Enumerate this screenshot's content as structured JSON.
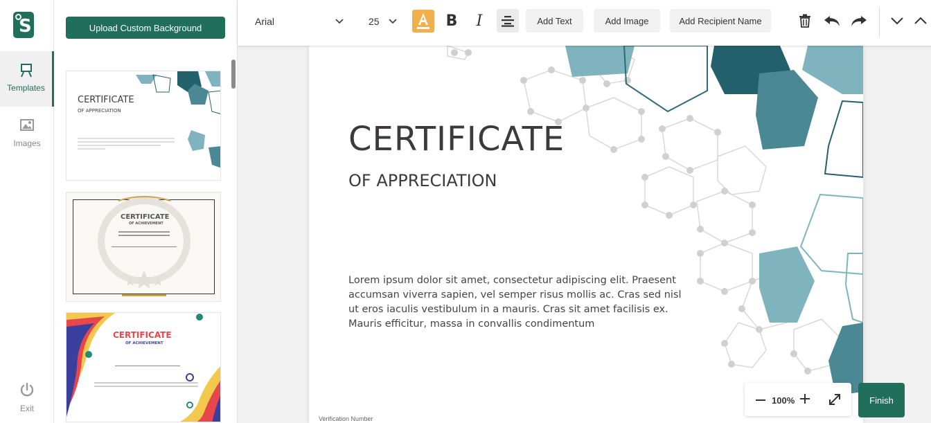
{
  "nav": {
    "items": [
      {
        "label": "Templates",
        "icon": "easel-icon",
        "active": true
      },
      {
        "label": "Images",
        "icon": "image-icon",
        "active": false
      }
    ],
    "exit_label": "Exit"
  },
  "panel": {
    "upload_label": "Upload Custom Background",
    "templates": [
      {
        "title": "CERTIFICATE",
        "subtitle": "OF APPRECIATION"
      },
      {
        "title": "CERTIFICATE",
        "subtitle": "OF ACHIEVEMENT"
      },
      {
        "title": "CERTIFICATE",
        "subtitle": "OF ACHIEVEMENT"
      }
    ]
  },
  "toolbar": {
    "font": "Arial",
    "font_size": "25",
    "add_text": "Add Text",
    "add_image": "Add Image",
    "add_recipient": "Add Recipient Name"
  },
  "certificate": {
    "title": "CERTIFICATE",
    "subtitle": "OF APPRECIATION",
    "body": "Lorem ipsum dolor sit amet, consectetur adipiscing elit. Praesent accumsan viverra sapien, vel semper risus mollis ac. Cras sed nisl ut eros iaculis vestibulum in a mauris. Cras sit amet facilisis ex. Mauris efficitur, massa in convallis condimentum",
    "verification": "Verification Number"
  },
  "zoom": {
    "level": "100%"
  },
  "finish_label": "Finish",
  "colors": {
    "brand": "#1f6f5a",
    "highlight": "#f1b04c",
    "teal_dark": "#245f6c",
    "teal_light": "#7fb3bd"
  }
}
